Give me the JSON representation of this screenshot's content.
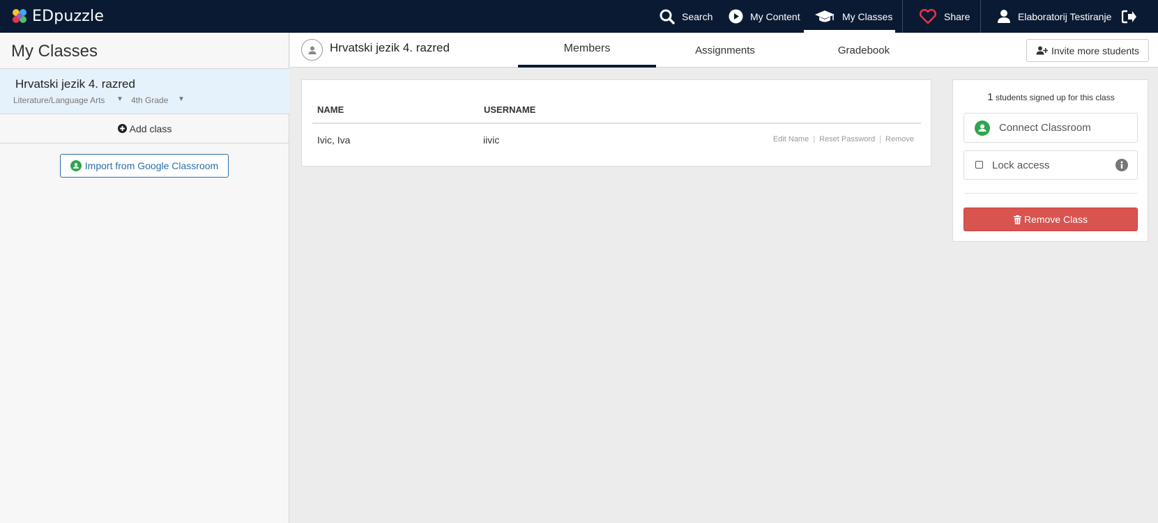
{
  "app": {
    "logo_text": "EDpuzzle"
  },
  "nav": {
    "search": "Search",
    "my_content": "My Content",
    "my_classes": "My Classes",
    "share": "Share",
    "user": "Elaboratorij Testiranje"
  },
  "sidebar": {
    "title": "My Classes",
    "classes": [
      {
        "name": "Hrvatski jezik 4. razred",
        "subject": "Literature/Language Arts",
        "grade": "4th Grade"
      }
    ],
    "add_class": "Add class",
    "import_button": "Import from Google Classroom"
  },
  "class_header": {
    "title": "Hrvatski jezik 4. razred",
    "tabs": [
      {
        "label": "Members",
        "active": true
      },
      {
        "label": "Assignments",
        "active": false
      },
      {
        "label": "Gradebook",
        "active": false
      }
    ],
    "invite_button": "Invite more students"
  },
  "members": {
    "columns": [
      "NAME",
      "USERNAME"
    ],
    "rows": [
      {
        "name": "Ivic, Iva",
        "username": "iivic"
      }
    ],
    "row_actions": [
      "Edit Name",
      "Reset Password",
      "Remove"
    ]
  },
  "side_panel": {
    "student_count": "1",
    "signed_text": "students signed up for this class",
    "connect_button": "Connect Classroom",
    "lock_label": "Lock access",
    "lock_checked": false,
    "remove_button": "Remove Class"
  },
  "colors": {
    "topbar": "#0b1a33",
    "selected_class_bg": "#e6f2fb",
    "link_blue": "#2a6ea6",
    "danger": "#d9534f",
    "google_green": "#2ea54f",
    "share_heart": "#e8334a"
  },
  "icons": {
    "search": "search-icon",
    "my_content": "play-circle-icon",
    "my_classes": "graduation-cap-icon",
    "share": "heart-icon",
    "user": "user-icon",
    "logout": "logout-icon",
    "add_class": "plus-circle-icon",
    "google_classroom": "google-classroom-icon",
    "invite": "user-plus-icon",
    "info": "info-icon",
    "trash": "trash-icon"
  }
}
